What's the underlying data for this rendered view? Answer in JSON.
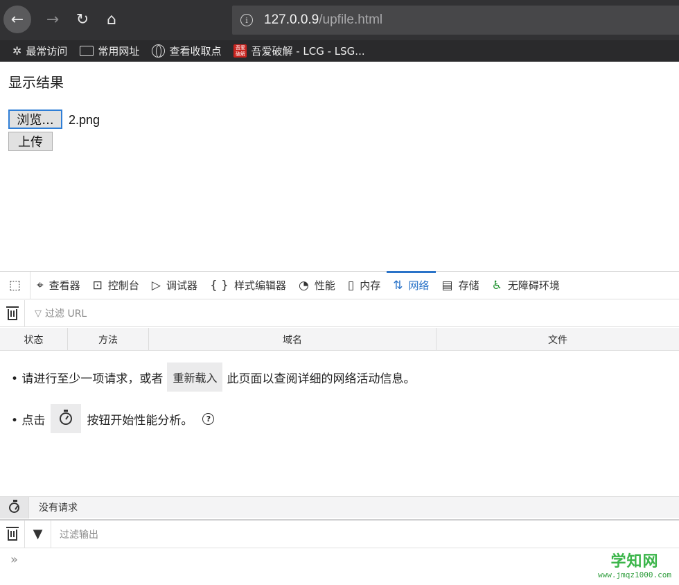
{
  "browser": {
    "url_host": "127.0.0.9",
    "url_path": "/upfile.html",
    "bookmarks": [
      {
        "label": "最常访问",
        "icon": "gear-icon"
      },
      {
        "label": "常用网址",
        "icon": "folder-icon"
      },
      {
        "label": "查看收取点",
        "icon": "globe-icon"
      },
      {
        "label": "吾爱破解 - LCG - LSG...",
        "icon": "site-favicon"
      }
    ]
  },
  "page": {
    "title": "显示结果",
    "browse_label": "浏览...",
    "file_name": "2.png",
    "upload_label": "上传"
  },
  "devtools": {
    "tabs": [
      {
        "label": "查看器",
        "icon": "inspector-icon"
      },
      {
        "label": "控制台",
        "icon": "console-icon"
      },
      {
        "label": "调试器",
        "icon": "debugger-icon"
      },
      {
        "label": "样式编辑器",
        "icon": "braces-icon"
      },
      {
        "label": "性能",
        "icon": "performance-icon"
      },
      {
        "label": "内存",
        "icon": "memory-icon"
      },
      {
        "label": "网络",
        "icon": "network-arrows-icon",
        "active": true
      },
      {
        "label": "存储",
        "icon": "storage-icon"
      },
      {
        "label": "无障碍环境",
        "icon": "accessibility-icon"
      }
    ],
    "net_filter_placeholder": "过滤 URL",
    "columns": [
      "状态",
      "方法",
      "域名",
      "文件"
    ],
    "notice": {
      "line1_prefix": "• 请进行至少一项请求，或者",
      "reload_label": "重新载入",
      "line1_suffix": "此页面以查阅详细的网络活动信息。",
      "line2_prefix": "• 点击",
      "line2_suffix": "按钮开始性能分析。"
    },
    "status_text": "没有请求",
    "console_filter_placeholder": "过滤输出"
  },
  "watermark": {
    "title": "学知网",
    "url": "www.jmqz1000.com"
  },
  "colors": {
    "accent": "#2a73c8",
    "chrome_dark": "#323234",
    "watermark_green": "#3bb54a"
  }
}
